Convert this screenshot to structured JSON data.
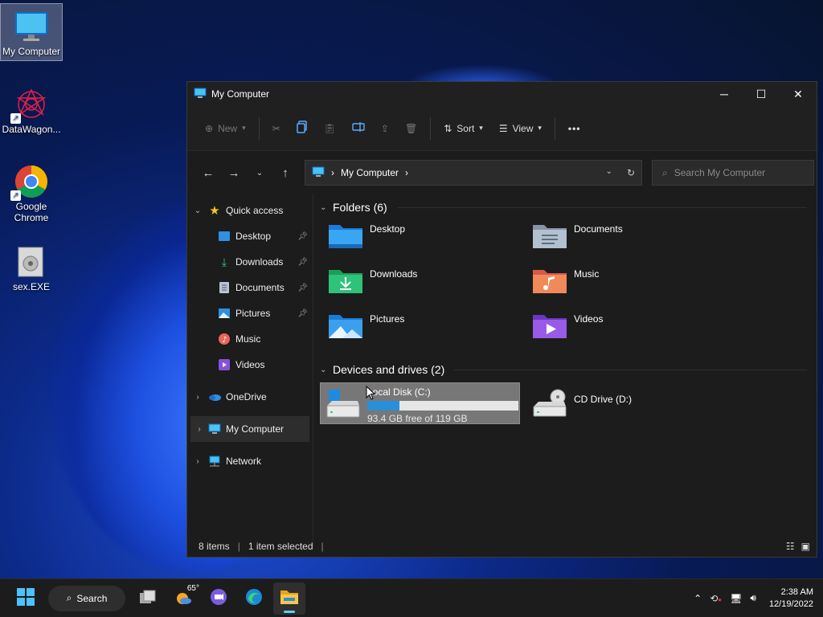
{
  "desktop": {
    "icons": [
      {
        "label": "My Computer",
        "icon": "monitor-icon"
      },
      {
        "label": "DataWagon...",
        "icon": "datawagon-icon"
      },
      {
        "label": "Google Chrome",
        "icon": "chrome-icon"
      },
      {
        "label": "sex.EXE",
        "icon": "exe-icon"
      }
    ]
  },
  "window": {
    "title": "My Computer",
    "toolbar": {
      "new_label": "New",
      "sort_label": "Sort",
      "view_label": "View",
      "more_label": "•••"
    },
    "address": {
      "location": "My Computer"
    },
    "search": {
      "placeholder": "Search My Computer"
    },
    "sidebar": {
      "quick_access": "Quick access",
      "pinned": [
        {
          "label": "Desktop",
          "icon": "desktop-folder-icon",
          "pinned": true
        },
        {
          "label": "Downloads",
          "icon": "downloads-icon",
          "pinned": true
        },
        {
          "label": "Documents",
          "icon": "documents-icon",
          "pinned": true
        },
        {
          "label": "Pictures",
          "icon": "pictures-icon",
          "pinned": true
        },
        {
          "label": "Music",
          "icon": "music-icon",
          "pinned": false
        },
        {
          "label": "Videos",
          "icon": "videos-icon",
          "pinned": false
        }
      ],
      "onedrive": "OneDrive",
      "my_computer": "My Computer",
      "network": "Network"
    },
    "folders_header": "Folders (6)",
    "folders": [
      {
        "label": "Desktop",
        "icon": "desktop-folder-icon"
      },
      {
        "label": "Documents",
        "icon": "documents-folder-icon"
      },
      {
        "label": "Downloads",
        "icon": "downloads-folder-icon"
      },
      {
        "label": "Music",
        "icon": "music-folder-icon"
      },
      {
        "label": "Pictures",
        "icon": "pictures-folder-icon"
      },
      {
        "label": "Videos",
        "icon": "videos-folder-icon"
      }
    ],
    "drives_header": "Devices and drives (2)",
    "drives": [
      {
        "label": "Local Disk (C:)",
        "free": "93.4 GB free of 119 GB",
        "used_fraction": 0.215,
        "selected": true
      },
      {
        "label": "CD Drive (D:)"
      }
    ],
    "status": {
      "items": "8 items",
      "selected": "1 item selected"
    }
  },
  "taskbar": {
    "search_label": "Search",
    "weather": "65°",
    "time": "2:38 AM",
    "date": "12/19/2022"
  },
  "colors": {
    "accent": "#60cdff",
    "progress": "#2a8fd9",
    "window_bg": "#1c1c1c"
  }
}
